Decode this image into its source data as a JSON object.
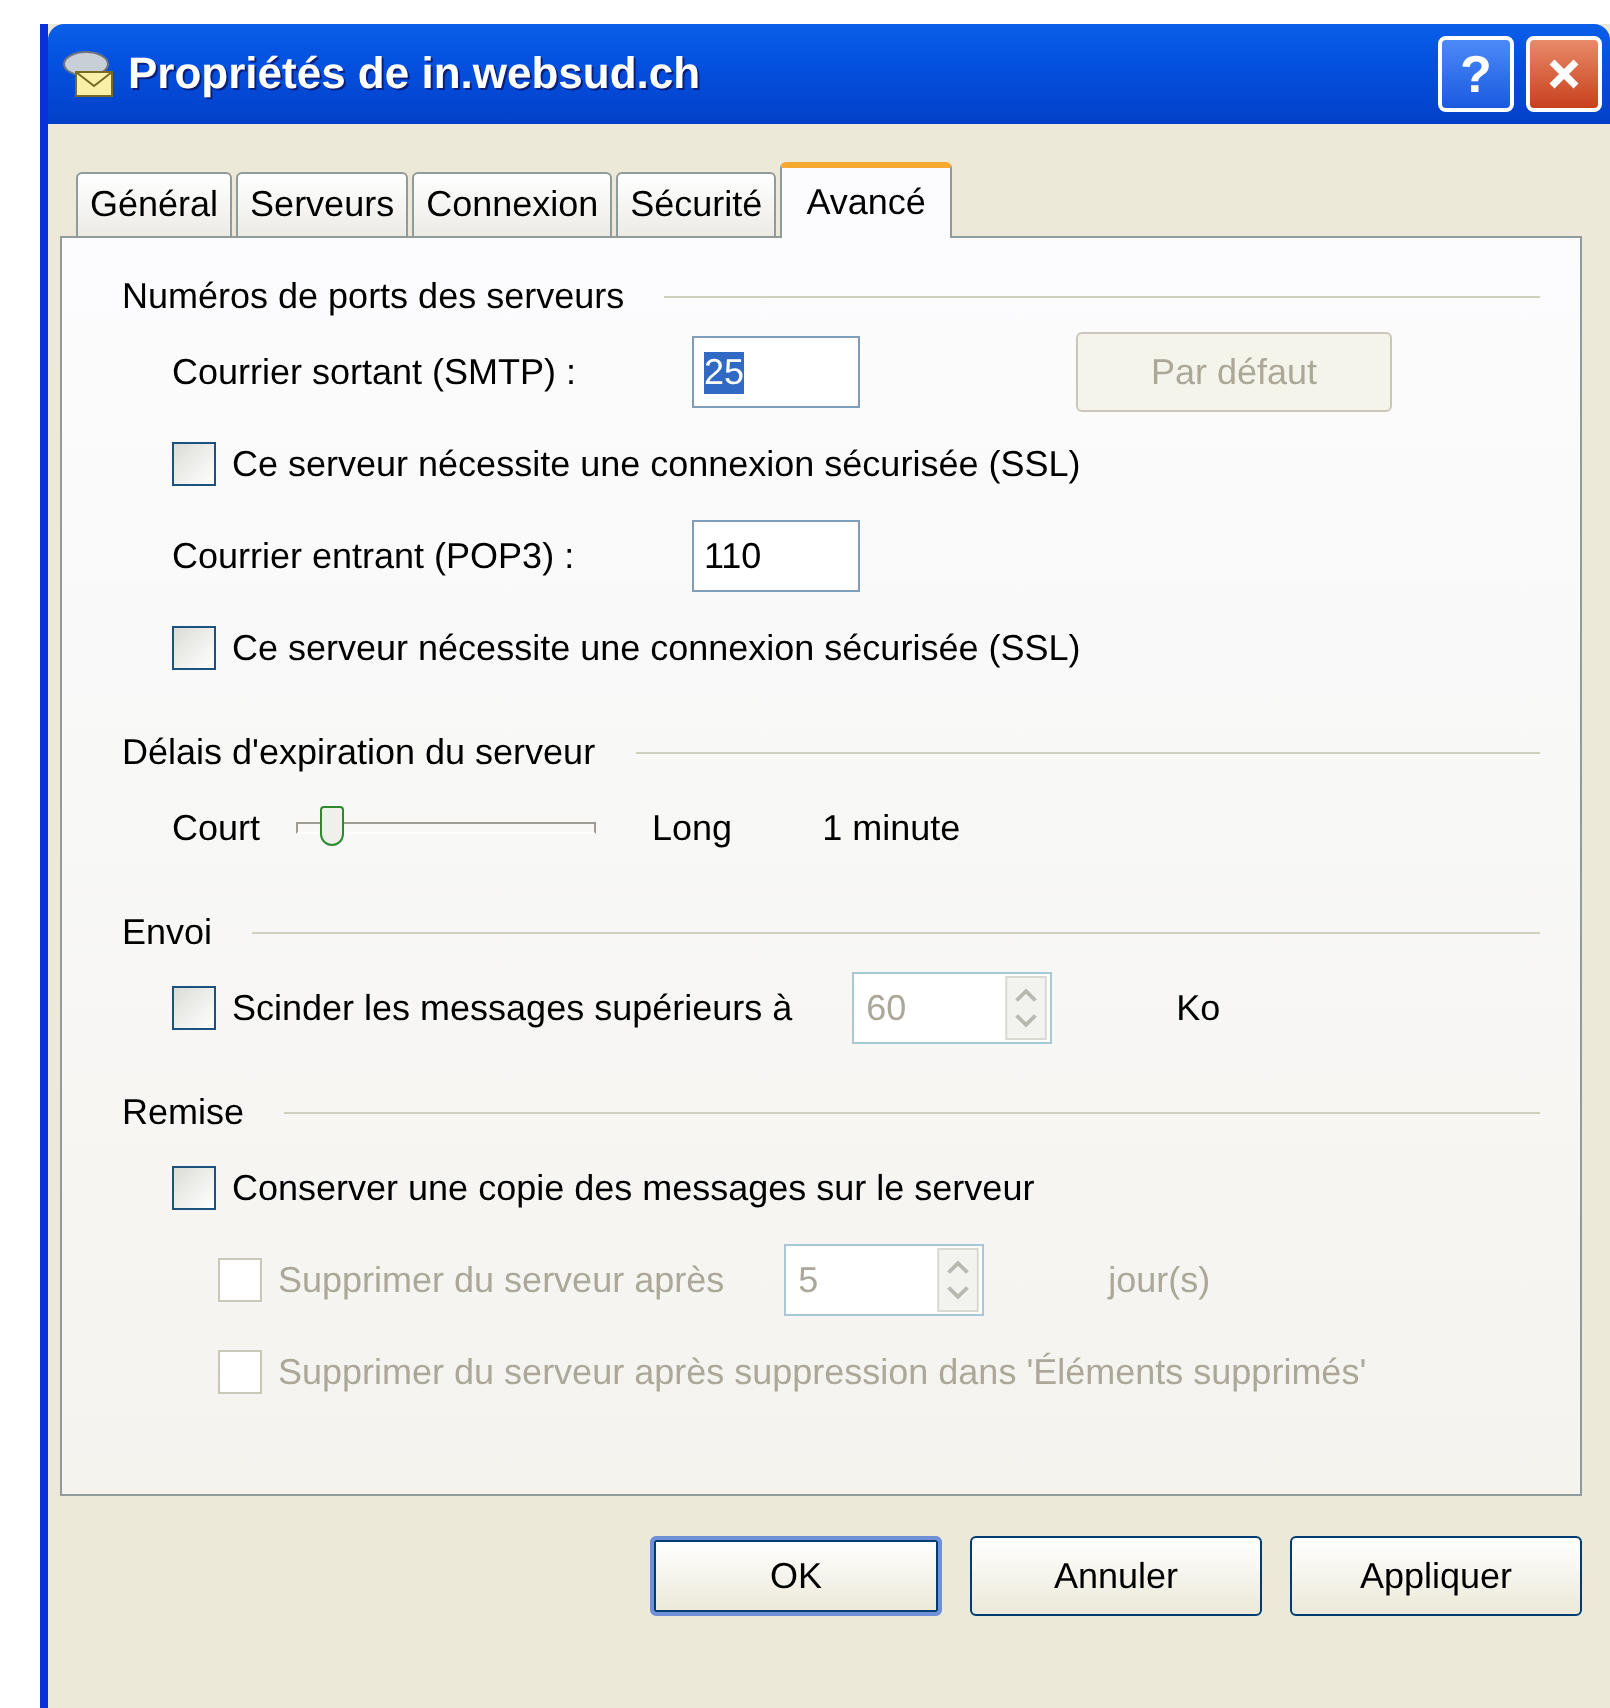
{
  "window": {
    "title": "Propriétés de in.websud.ch",
    "help_button": "?"
  },
  "tabs": [
    {
      "label": "Général",
      "selected": false
    },
    {
      "label": "Serveurs",
      "selected": false
    },
    {
      "label": "Connexion",
      "selected": false
    },
    {
      "label": "Sécurité",
      "selected": false
    },
    {
      "label": "Avancé",
      "selected": true
    }
  ],
  "sections": [
    {
      "title": "Numéros de ports des serveurs",
      "rows": [
        {
          "kind": "field",
          "label": "Courrier sortant (SMTP) :",
          "value": "25",
          "highlighted": true,
          "button": {
            "label": "Par défaut",
            "disabled": true
          }
        },
        {
          "kind": "checkbox",
          "label": "Ce serveur nécessite une connexion sécurisée (SSL)",
          "checked": false,
          "disabled": false
        },
        {
          "kind": "field",
          "label": "Courrier entrant (POP3) :",
          "value": "110",
          "highlighted": false
        },
        {
          "kind": "checkbox",
          "label": "Ce serveur nécessite une connexion sécurisée (SSL)",
          "checked": false,
          "disabled": false
        }
      ]
    },
    {
      "title": "Délais d'expiration du serveur",
      "rows": [
        {
          "kind": "slider",
          "min_label": "Court",
          "max_label": "Long",
          "level": 0.12,
          "reading": "1 minute"
        }
      ]
    },
    {
      "title": "Envoi",
      "rows": [
        {
          "kind": "checkbox_spin",
          "label": "Scinder les messages supérieurs à",
          "checked": false,
          "disabled": false,
          "value": "60",
          "spin_disabled": true,
          "unit": "Ko"
        }
      ]
    },
    {
      "title": "Remise",
      "rows": [
        {
          "kind": "checkbox",
          "label": "Conserver une copie des messages sur le serveur",
          "checked": false,
          "disabled": false,
          "children": [
            {
              "kind": "checkbox_spin",
              "label": "Supprimer du serveur après",
              "checked": false,
              "disabled": true,
              "value": "5",
              "spin_disabled": true,
              "unit": "jour(s)"
            },
            {
              "kind": "checkbox",
              "label": "Supprimer du serveur après suppression dans 'Éléments supprimés'",
              "checked": false,
              "disabled": true
            }
          ]
        }
      ]
    }
  ],
  "buttons": [
    {
      "label": "OK",
      "default": true
    },
    {
      "label": "Annuler",
      "default": false
    },
    {
      "label": "Appliquer",
      "default": false
    }
  ]
}
